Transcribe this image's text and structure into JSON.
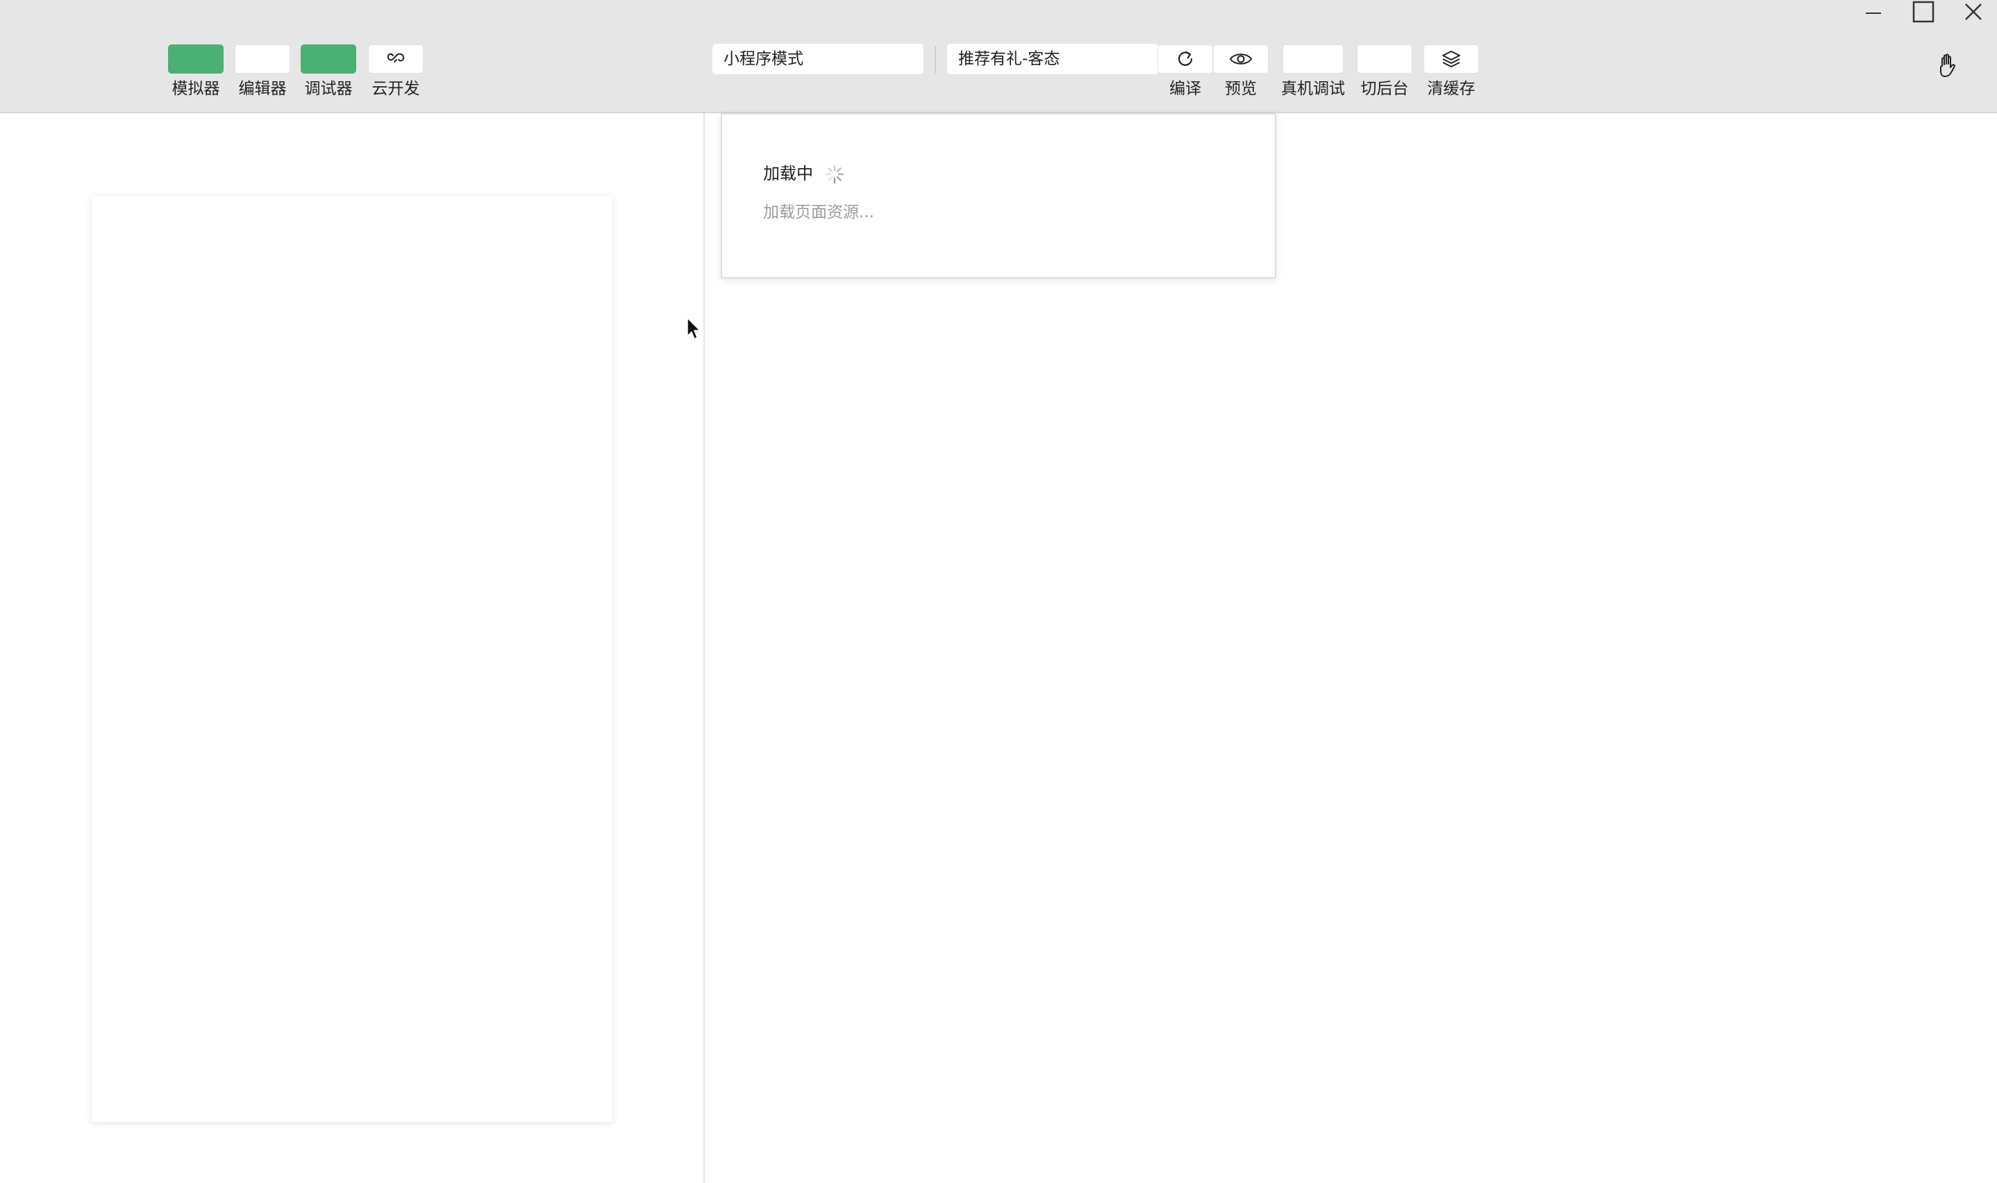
{
  "toolbar": {
    "left_tools": [
      {
        "label": "模拟器",
        "active": true
      },
      {
        "label": "编辑器",
        "active": false
      },
      {
        "label": "调试器",
        "active": true
      },
      {
        "label": "云开发",
        "icon": "cloud-link-icon"
      }
    ],
    "mode_select": {
      "value": "小程序模式"
    },
    "compile_select": {
      "value": "推荐有礼-客态"
    },
    "right_tools": [
      {
        "label": "编译",
        "icon": "refresh-icon"
      },
      {
        "label": "预览",
        "icon": "eye-icon"
      },
      {
        "label": "真机调试"
      },
      {
        "label": "切后台"
      },
      {
        "label": "清缓存",
        "icon": "layers-icon"
      }
    ],
    "accent_color": "#4caf73"
  },
  "window_controls": [
    "minimize-icon",
    "maximize-icon",
    "close-icon"
  ],
  "loading_panel": {
    "title": "加载中",
    "subtitle": "加载页面资源..."
  }
}
